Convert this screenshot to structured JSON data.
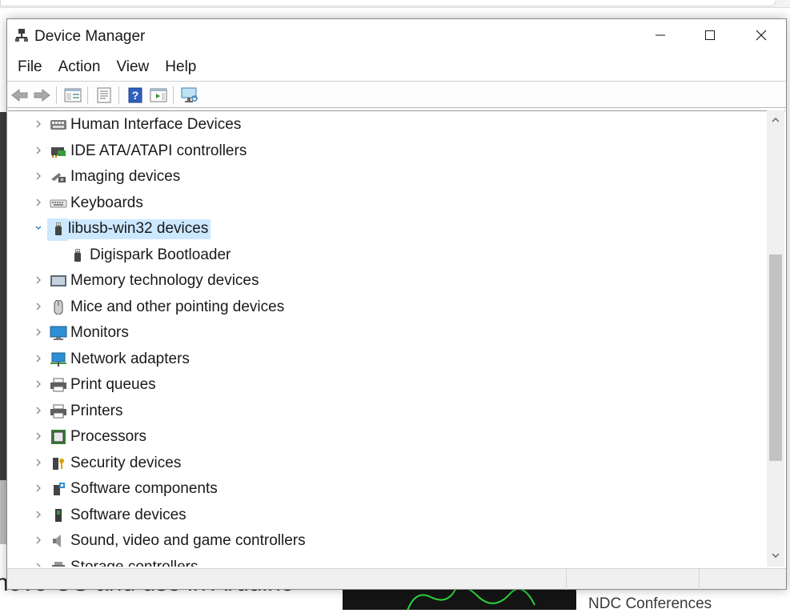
{
  "window": {
    "title": "Device Manager"
  },
  "menu": [
    "File",
    "Action",
    "View",
    "Help"
  ],
  "tree": [
    {
      "label": "Human Interface Devices",
      "icon": "hid-icon",
      "indent": 0,
      "expander": "right"
    },
    {
      "label": "IDE ATA/ATAPI controllers",
      "icon": "ide-controller-icon",
      "indent": 0,
      "expander": "right"
    },
    {
      "label": "Imaging devices",
      "icon": "camera-icon",
      "indent": 0,
      "expander": "right"
    },
    {
      "label": "Keyboards",
      "icon": "keyboard-icon",
      "indent": 0,
      "expander": "right"
    },
    {
      "label": "libusb-win32 devices",
      "icon": "usb-icon",
      "indent": 0,
      "expander": "down",
      "selected": true
    },
    {
      "label": "Digispark Bootloader",
      "icon": "usb-icon",
      "indent": 1,
      "expander": "none"
    },
    {
      "label": "Memory technology devices",
      "icon": "memory-device-icon",
      "indent": 0,
      "expander": "right"
    },
    {
      "label": "Mice and other pointing devices",
      "icon": "mouse-icon",
      "indent": 0,
      "expander": "right"
    },
    {
      "label": "Monitors",
      "icon": "monitor-icon",
      "indent": 0,
      "expander": "right"
    },
    {
      "label": "Network adapters",
      "icon": "network-adapter-icon",
      "indent": 0,
      "expander": "right"
    },
    {
      "label": "Print queues",
      "icon": "printer-icon",
      "indent": 0,
      "expander": "right"
    },
    {
      "label": "Printers",
      "icon": "printer-icon",
      "indent": 0,
      "expander": "right"
    },
    {
      "label": "Processors",
      "icon": "processor-icon",
      "indent": 0,
      "expander": "right"
    },
    {
      "label": "Security devices",
      "icon": "security-device-icon",
      "indent": 0,
      "expander": "right"
    },
    {
      "label": "Software components",
      "icon": "software-component-icon",
      "indent": 0,
      "expander": "right"
    },
    {
      "label": "Software devices",
      "icon": "software-device-icon",
      "indent": 0,
      "expander": "right"
    },
    {
      "label": "Sound, video and game controllers",
      "icon": "speaker-icon",
      "indent": 0,
      "expander": "right"
    },
    {
      "label": "Storage controllers",
      "icon": "storage-controller-icon",
      "indent": 0,
      "expander": "right"
    }
  ],
  "background": {
    "bottom_text": "nove OS and use in Arduino",
    "ndc_text": "NDC Conferences"
  },
  "colors": {
    "selection": "#cce8ff",
    "accent": "#0078d7"
  }
}
